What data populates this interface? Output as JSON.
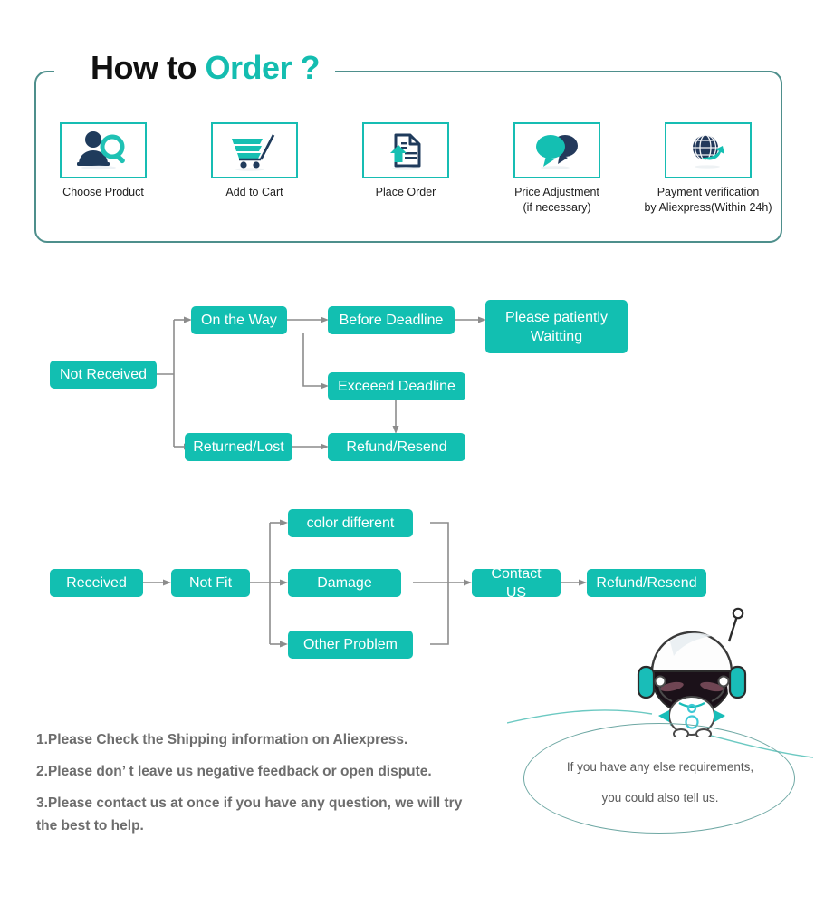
{
  "header": {
    "title_part1": "How to ",
    "title_part2": "Order ?",
    "accent_color": "#14bdb0",
    "frame_color": "#4e8f8c"
  },
  "steps": [
    {
      "icon": "person-search-icon",
      "label_line1": "Choose  Product",
      "label_line2": ""
    },
    {
      "icon": "shopping-cart-icon",
      "label_line1": "Add to Cart",
      "label_line2": ""
    },
    {
      "icon": "document-upload-icon",
      "label_line1": "Place  Order",
      "label_line2": ""
    },
    {
      "icon": "speech-bubbles-icon",
      "label_line1": "Price Adjustment",
      "label_line2": "(if necessary)"
    },
    {
      "icon": "globe-arrow-icon",
      "label_line1": "Payment verification",
      "label_line2": "by Aliexpress(Within 24h)"
    }
  ],
  "flow_not_received": {
    "node_color": "#12bfb1",
    "nodes": {
      "start": "Not Received",
      "on_the_way": "On the Way",
      "before_deadline": "Before Deadline",
      "please_wait": "Please patiently\nWaitting",
      "exceed_deadline": "Exceeed Deadline",
      "returned_lost": "Returned/Lost",
      "refund_resend": "Refund/Resend"
    }
  },
  "flow_received": {
    "nodes": {
      "start": "Received",
      "not_fit": "Not Fit",
      "color_different": "color different",
      "damage": "Damage",
      "other_problem": "Other Problem",
      "contact_us": "Contact US",
      "refund_resend": "Refund/Resend"
    }
  },
  "notes": [
    "1.Please Check the Shipping information on Aliexpress.",
    "2.Please don’ t leave us negative feedback or open dispute.",
    "3.Please contact us at once if you have any question, we will try",
    " the best to help."
  ],
  "bubble": {
    "line1": "If you have any else requirements,",
    "line2": "you could also tell us.",
    "border_color": "#6fa8a4"
  }
}
